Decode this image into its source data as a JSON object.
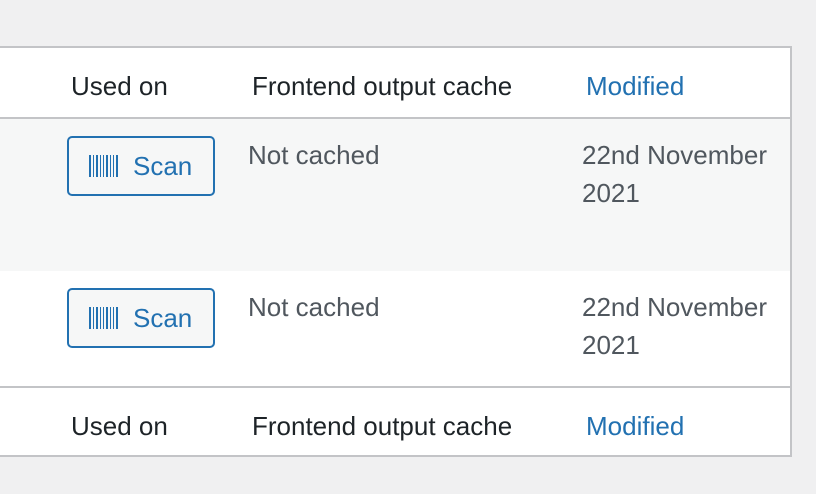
{
  "table": {
    "columns": {
      "used_on": "Used on",
      "frontend_output_cache": "Frontend output cache",
      "modified": "Modified"
    },
    "rows": [
      {
        "scan_label": "Scan",
        "cache_status": "Not cached",
        "modified_line1": "22nd November",
        "modified_line2": "2021"
      },
      {
        "scan_label": "Scan",
        "cache_status": "Not cached",
        "modified_line1": "22nd November",
        "modified_line2": "2021"
      }
    ]
  },
  "colors": {
    "link": "#2271b1",
    "text": "#1d2327",
    "muted_text": "#50575e",
    "border": "#c3c4c7",
    "page_bg": "#f0f0f1",
    "alt_row_bg": "#f6f7f7"
  },
  "icons": {
    "scan_button_icon": "barcode-icon"
  }
}
